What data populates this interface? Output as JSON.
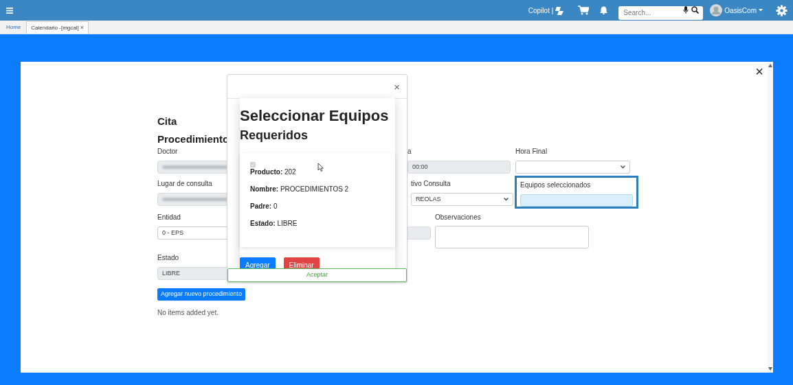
{
  "topbar": {
    "copilot_label": "Copilot |",
    "search": {
      "placeholder": "Search..."
    },
    "user": "OasisCom"
  },
  "tabs": [
    {
      "label": "Home",
      "selected": false,
      "closable": false
    },
    {
      "label": "Calendario -[mgcal]",
      "selected": true,
      "closable": true,
      "close_glyph": "×"
    }
  ],
  "panel": {
    "close_glyph": "×"
  },
  "form": {
    "title": "Cita",
    "subtitle": "Procedimiento",
    "rows": [
      [
        {
          "kind": "blurred",
          "label": "Doctor"
        },
        {
          "kind": "text",
          "label": "a",
          "value": "00:00",
          "disabled": true
        },
        {
          "kind": "select",
          "label": "Hora Final"
        }
      ],
      [
        {
          "kind": "blurred",
          "label": "Lugar de consulta"
        },
        {
          "kind": "select",
          "label": "tivo Consulta",
          "value": "REOLAS"
        },
        {
          "kind": "text",
          "label": "Equipos seleccionados",
          "disabled": false,
          "highlighted": true
        }
      ],
      [
        {
          "kind": "text",
          "label": "Entidad",
          "value": "0 - EPS",
          "disabled": false
        },
        {
          "kind": "text",
          "disabled": true
        },
        {
          "kind": "textarea",
          "label": "Observaciones"
        }
      ],
      [
        {
          "kind": "text",
          "label": "Estado",
          "value": "LIBRE",
          "disabled": true
        }
      ]
    ],
    "add_button": "Agregar nuevo procedimiento",
    "empty_text": "No items added yet."
  },
  "modal": {
    "close_glyph": "×",
    "title": "Seleccionar Equipos",
    "subtitle": "Requeridos",
    "item": {
      "checked": true,
      "disabled": true,
      "lines": [
        "**Producto:** 202",
        "**Nombre:** PROCEDIMIENTOS 2",
        "**Padre:** 0",
        "**Estado:** LIBRE"
      ]
    },
    "buttons": [
      {
        "kind": "primary",
        "label": "Agregar"
      },
      {
        "kind": "danger",
        "label": "Eliminar"
      }
    ],
    "footer_button": "Aceptar"
  }
}
